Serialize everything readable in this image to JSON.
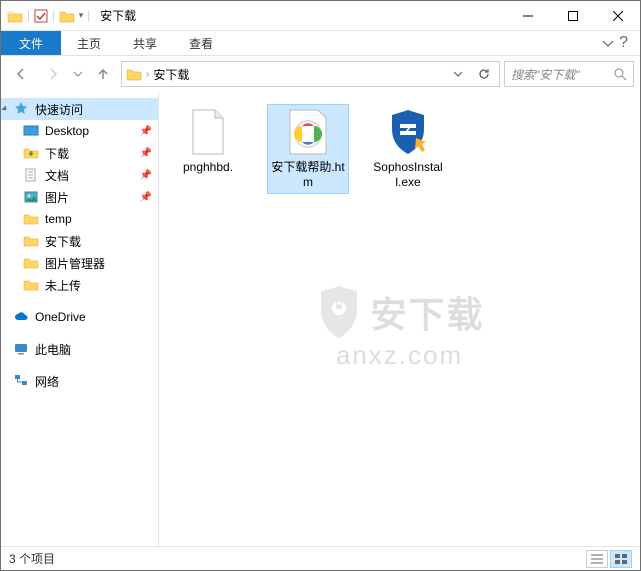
{
  "window": {
    "title": "安下载"
  },
  "ribbon": {
    "file": "文件",
    "tabs": [
      "主页",
      "共享",
      "查看"
    ]
  },
  "address": {
    "path": "安下载",
    "search_placeholder": "搜索\"安下载\""
  },
  "sidebar": {
    "quick_access": "快速访问",
    "items": [
      {
        "label": "Desktop",
        "pinned": true,
        "icon": "desktop"
      },
      {
        "label": "下载",
        "pinned": true,
        "icon": "downloads"
      },
      {
        "label": "文档",
        "pinned": true,
        "icon": "documents"
      },
      {
        "label": "图片",
        "pinned": true,
        "icon": "pictures"
      },
      {
        "label": "temp",
        "pinned": false,
        "icon": "folder"
      },
      {
        "label": "安下载",
        "pinned": false,
        "icon": "folder"
      },
      {
        "label": "图片管理器",
        "pinned": false,
        "icon": "folder"
      },
      {
        "label": "未上传",
        "pinned": false,
        "icon": "folder"
      }
    ],
    "onedrive": "OneDrive",
    "thispc": "此电脑",
    "network": "网络"
  },
  "files": [
    {
      "label": "pnghhbd.",
      "icon": "blank",
      "selected": false
    },
    {
      "label": "安下载帮助.htm",
      "icon": "htm",
      "selected": true
    },
    {
      "label": "SophosInstall.exe",
      "icon": "sophos",
      "selected": false
    }
  ],
  "watermark": {
    "top": "安下载",
    "bottom": "anxz.com"
  },
  "status": {
    "count": "3 个项目"
  }
}
